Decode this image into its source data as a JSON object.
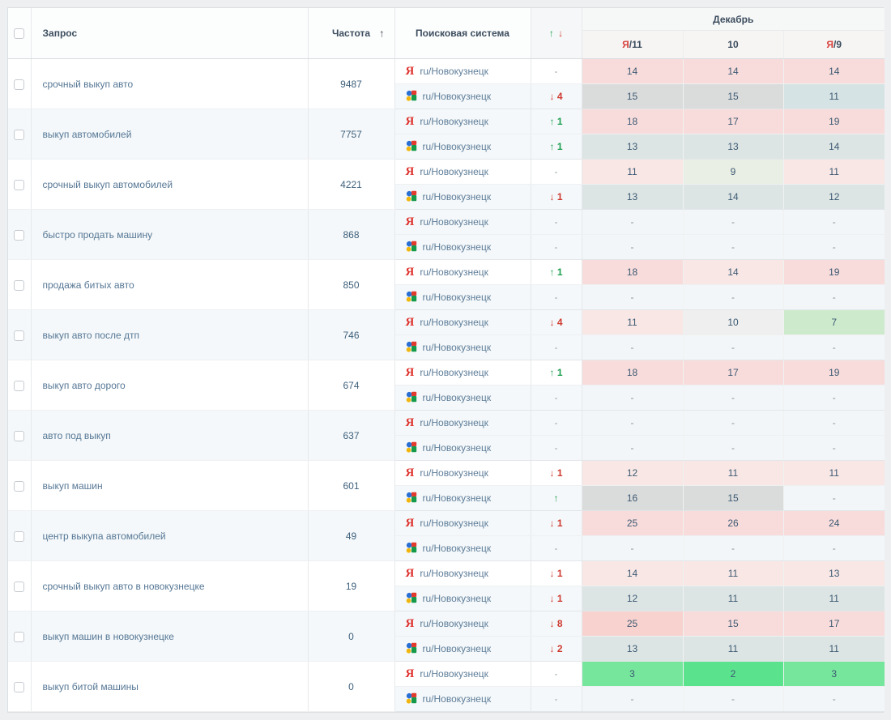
{
  "header": {
    "query_label": "Запрос",
    "frequency_label": "Частота",
    "frequency_sort_icon": "↑",
    "engine_label": "Поисковая система",
    "change_up_icon": "↑",
    "change_down_icon": "↓",
    "month_label": "Декабрь",
    "dates": [
      {
        "ya_prefix": "Я",
        "label": "/11"
      },
      {
        "ya_prefix": "",
        "label": "10"
      },
      {
        "ya_prefix": "Я",
        "label": "/9"
      }
    ]
  },
  "region": "ru/Новокузнецк",
  "yandex_glyph": "Я",
  "colors": {
    "pink": "#f8dcdb",
    "lightpink": "#f8e7e5",
    "deeppink": "#f8d2cf",
    "palegreen": "#e9efe4",
    "lightgreen": "#cdeacd",
    "green": "#76e69c",
    "brightgreen": "#5be28d",
    "gray": "#dadbdb",
    "lightgray": "#eeefee",
    "tealgray": "#dde5e4",
    "bluegray": "#d6e3e4",
    "none": "#f3f6f8",
    "change_up": "#1d9e50",
    "change_down": "#cf3a30",
    "yandex_red": "#df342f"
  },
  "rows": [
    {
      "query": "срочный выкуп авто",
      "frequency": "9487",
      "engines": [
        {
          "engine": "yandex",
          "change": {
            "dir": "none",
            "num": ""
          },
          "cells": [
            {
              "v": "14",
              "bg": "pink"
            },
            {
              "v": "14",
              "bg": "pink"
            },
            {
              "v": "14",
              "bg": "pink"
            }
          ]
        },
        {
          "engine": "google",
          "change": {
            "dir": "down",
            "num": "4"
          },
          "cells": [
            {
              "v": "15",
              "bg": "gray"
            },
            {
              "v": "15",
              "bg": "gray"
            },
            {
              "v": "11",
              "bg": "bluegray"
            }
          ]
        }
      ]
    },
    {
      "query": "выкуп автомобилей",
      "frequency": "7757",
      "engines": [
        {
          "engine": "yandex",
          "change": {
            "dir": "up",
            "num": "1"
          },
          "cells": [
            {
              "v": "18",
              "bg": "pink"
            },
            {
              "v": "17",
              "bg": "pink"
            },
            {
              "v": "19",
              "bg": "pink"
            }
          ]
        },
        {
          "engine": "google",
          "change": {
            "dir": "up",
            "num": "1"
          },
          "cells": [
            {
              "v": "13",
              "bg": "tealgray"
            },
            {
              "v": "13",
              "bg": "tealgray"
            },
            {
              "v": "14",
              "bg": "tealgray"
            }
          ]
        }
      ]
    },
    {
      "query": "срочный выкуп автомобилей",
      "frequency": "4221",
      "engines": [
        {
          "engine": "yandex",
          "change": {
            "dir": "none",
            "num": ""
          },
          "cells": [
            {
              "v": "11",
              "bg": "lightpink"
            },
            {
              "v": "9",
              "bg": "palegreen"
            },
            {
              "v": "11",
              "bg": "lightpink"
            }
          ]
        },
        {
          "engine": "google",
          "change": {
            "dir": "down",
            "num": "1"
          },
          "cells": [
            {
              "v": "13",
              "bg": "tealgray"
            },
            {
              "v": "14",
              "bg": "tealgray"
            },
            {
              "v": "12",
              "bg": "tealgray"
            }
          ]
        }
      ]
    },
    {
      "query": "быстро продать машину",
      "frequency": "868",
      "engines": [
        {
          "engine": "yandex",
          "change": {
            "dir": "none",
            "num": ""
          },
          "cells": [
            {
              "v": "-",
              "bg": "none"
            },
            {
              "v": "-",
              "bg": "none"
            },
            {
              "v": "-",
              "bg": "none"
            }
          ]
        },
        {
          "engine": "google",
          "change": {
            "dir": "none",
            "num": ""
          },
          "cells": [
            {
              "v": "-",
              "bg": "none"
            },
            {
              "v": "-",
              "bg": "none"
            },
            {
              "v": "-",
              "bg": "none"
            }
          ]
        }
      ]
    },
    {
      "query": "продажа битых авто",
      "frequency": "850",
      "engines": [
        {
          "engine": "yandex",
          "change": {
            "dir": "up",
            "num": "1"
          },
          "cells": [
            {
              "v": "18",
              "bg": "pink"
            },
            {
              "v": "14",
              "bg": "lightpink"
            },
            {
              "v": "19",
              "bg": "pink"
            }
          ]
        },
        {
          "engine": "google",
          "change": {
            "dir": "none",
            "num": ""
          },
          "cells": [
            {
              "v": "-",
              "bg": "none"
            },
            {
              "v": "-",
              "bg": "none"
            },
            {
              "v": "-",
              "bg": "none"
            }
          ]
        }
      ]
    },
    {
      "query": "выкуп авто после дтп",
      "frequency": "746",
      "engines": [
        {
          "engine": "yandex",
          "change": {
            "dir": "down",
            "num": "4"
          },
          "cells": [
            {
              "v": "11",
              "bg": "lightpink"
            },
            {
              "v": "10",
              "bg": "lightgray"
            },
            {
              "v": "7",
              "bg": "lightgreen"
            }
          ]
        },
        {
          "engine": "google",
          "change": {
            "dir": "none",
            "num": ""
          },
          "cells": [
            {
              "v": "-",
              "bg": "none"
            },
            {
              "v": "-",
              "bg": "none"
            },
            {
              "v": "-",
              "bg": "none"
            }
          ]
        }
      ]
    },
    {
      "query": "выкуп авто дорого",
      "frequency": "674",
      "engines": [
        {
          "engine": "yandex",
          "change": {
            "dir": "up",
            "num": "1"
          },
          "cells": [
            {
              "v": "18",
              "bg": "pink"
            },
            {
              "v": "17",
              "bg": "pink"
            },
            {
              "v": "19",
              "bg": "pink"
            }
          ]
        },
        {
          "engine": "google",
          "change": {
            "dir": "none",
            "num": ""
          },
          "cells": [
            {
              "v": "-",
              "bg": "none"
            },
            {
              "v": "-",
              "bg": "none"
            },
            {
              "v": "-",
              "bg": "none"
            }
          ]
        }
      ]
    },
    {
      "query": "авто под выкуп",
      "frequency": "637",
      "engines": [
        {
          "engine": "yandex",
          "change": {
            "dir": "none",
            "num": ""
          },
          "cells": [
            {
              "v": "-",
              "bg": "none"
            },
            {
              "v": "-",
              "bg": "none"
            },
            {
              "v": "-",
              "bg": "none"
            }
          ]
        },
        {
          "engine": "google",
          "change": {
            "dir": "none",
            "num": ""
          },
          "cells": [
            {
              "v": "-",
              "bg": "none"
            },
            {
              "v": "-",
              "bg": "none"
            },
            {
              "v": "-",
              "bg": "none"
            }
          ]
        }
      ]
    },
    {
      "query": "выкуп машин",
      "frequency": "601",
      "engines": [
        {
          "engine": "yandex",
          "change": {
            "dir": "down",
            "num": "1"
          },
          "cells": [
            {
              "v": "12",
              "bg": "lightpink"
            },
            {
              "v": "11",
              "bg": "lightpink"
            },
            {
              "v": "11",
              "bg": "lightpink"
            }
          ]
        },
        {
          "engine": "google",
          "change": {
            "dir": "up",
            "num": ""
          },
          "cells": [
            {
              "v": "16",
              "bg": "gray"
            },
            {
              "v": "15",
              "bg": "gray"
            },
            {
              "v": "-",
              "bg": "none"
            }
          ]
        }
      ]
    },
    {
      "query": "центр выкупа автомобилей",
      "frequency": "49",
      "engines": [
        {
          "engine": "yandex",
          "change": {
            "dir": "down",
            "num": "1"
          },
          "cells": [
            {
              "v": "25",
              "bg": "pink"
            },
            {
              "v": "26",
              "bg": "pink"
            },
            {
              "v": "24",
              "bg": "pink"
            }
          ]
        },
        {
          "engine": "google",
          "change": {
            "dir": "none",
            "num": ""
          },
          "cells": [
            {
              "v": "-",
              "bg": "none"
            },
            {
              "v": "-",
              "bg": "none"
            },
            {
              "v": "-",
              "bg": "none"
            }
          ]
        }
      ]
    },
    {
      "query": "срочный выкуп авто в новокузнецке",
      "frequency": "19",
      "engines": [
        {
          "engine": "yandex",
          "change": {
            "dir": "down",
            "num": "1"
          },
          "cells": [
            {
              "v": "14",
              "bg": "lightpink"
            },
            {
              "v": "11",
              "bg": "lightpink"
            },
            {
              "v": "13",
              "bg": "lightpink"
            }
          ]
        },
        {
          "engine": "google",
          "change": {
            "dir": "down",
            "num": "1"
          },
          "cells": [
            {
              "v": "12",
              "bg": "tealgray"
            },
            {
              "v": "11",
              "bg": "tealgray"
            },
            {
              "v": "11",
              "bg": "tealgray"
            }
          ]
        }
      ]
    },
    {
      "query": "выкуп машин в новокузнецке",
      "frequency": "0",
      "engines": [
        {
          "engine": "yandex",
          "change": {
            "dir": "down",
            "num": "8"
          },
          "cells": [
            {
              "v": "25",
              "bg": "deeppink"
            },
            {
              "v": "15",
              "bg": "pink"
            },
            {
              "v": "17",
              "bg": "pink"
            }
          ]
        },
        {
          "engine": "google",
          "change": {
            "dir": "down",
            "num": "2"
          },
          "cells": [
            {
              "v": "13",
              "bg": "tealgray"
            },
            {
              "v": "11",
              "bg": "tealgray"
            },
            {
              "v": "11",
              "bg": "tealgray"
            }
          ]
        }
      ]
    },
    {
      "query": "выкуп битой машины",
      "frequency": "0",
      "engines": [
        {
          "engine": "yandex",
          "change": {
            "dir": "none",
            "num": ""
          },
          "cells": [
            {
              "v": "3",
              "bg": "green"
            },
            {
              "v": "2",
              "bg": "brightgreen"
            },
            {
              "v": "3",
              "bg": "green"
            }
          ]
        },
        {
          "engine": "google",
          "change": {
            "dir": "none",
            "num": ""
          },
          "cells": [
            {
              "v": "-",
              "bg": "none"
            },
            {
              "v": "-",
              "bg": "none"
            },
            {
              "v": "-",
              "bg": "none"
            }
          ]
        }
      ]
    }
  ]
}
